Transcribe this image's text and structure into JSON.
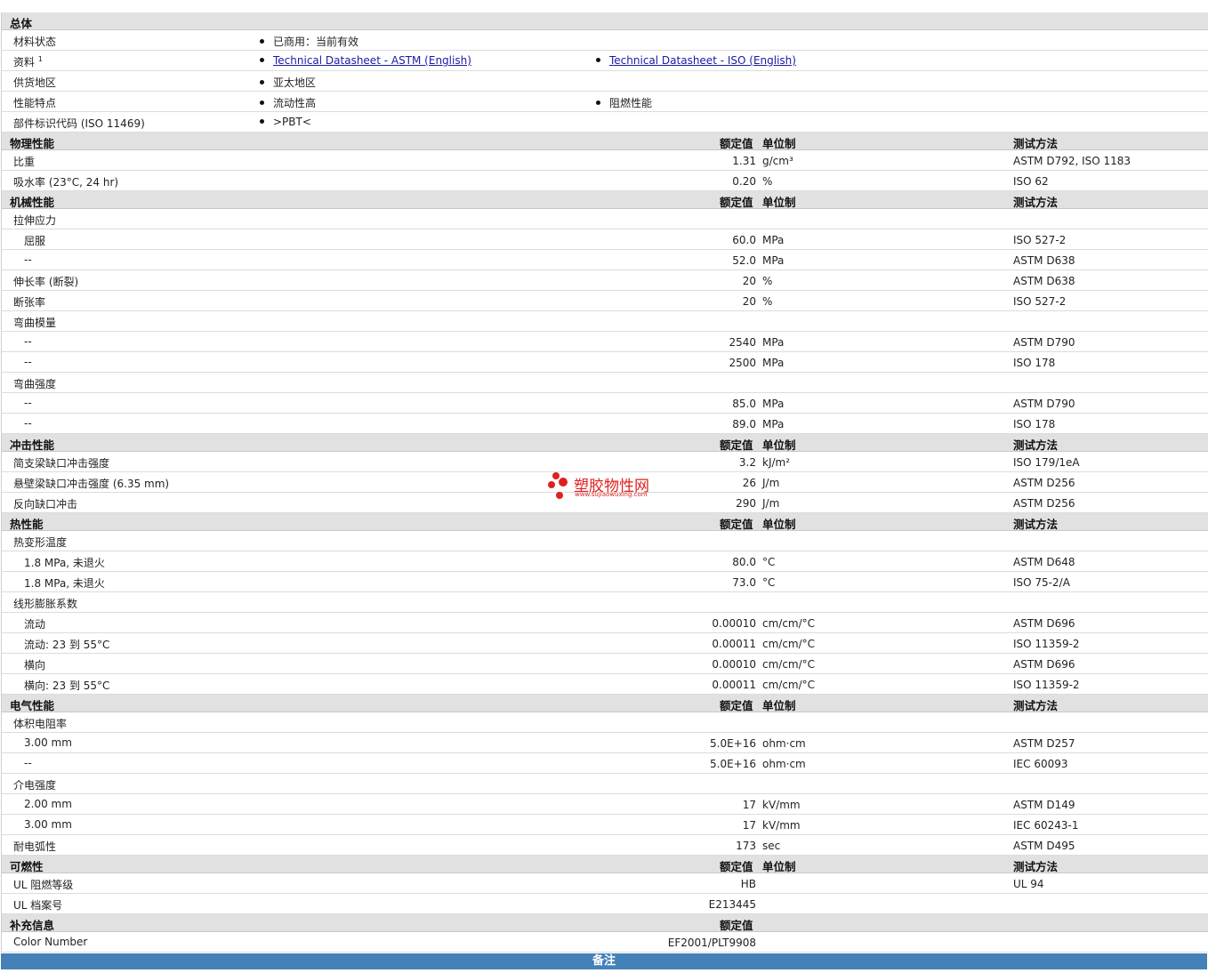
{
  "general": {
    "title": "总体",
    "rows": [
      {
        "label": "材料状态",
        "items": [
          "已商用：当前有效"
        ]
      },
      {
        "label": "资料",
        "sup": "1",
        "links": [
          "Technical Datasheet - ASTM (English)",
          "Technical Datasheet - ISO (English)"
        ]
      },
      {
        "label": "供货地区",
        "items": [
          "亚太地区"
        ]
      },
      {
        "label": "性能特点",
        "items": [
          "流动性高",
          "阻燃性能"
        ]
      },
      {
        "label": "部件标识代码 (ISO 11469)",
        "items": [
          ">PBT<"
        ]
      }
    ]
  },
  "col_headers": {
    "value": "额定值",
    "unit": "单位制",
    "method": "测试方法"
  },
  "physical": {
    "title": "物理性能",
    "rows": [
      {
        "name": "比重",
        "value": "1.31",
        "unit": "g/cm³",
        "method": "ASTM D792, ISO 1183"
      },
      {
        "name": "吸水率 (23°C, 24 hr)",
        "value": "0.20",
        "unit": "%",
        "method": "ISO 62"
      }
    ]
  },
  "mechanical": {
    "title": "机械性能",
    "rows": [
      {
        "name": "拉伸应力",
        "value": "",
        "unit": "",
        "method": ""
      },
      {
        "name": "屈服",
        "value": "60.0",
        "unit": "MPa",
        "method": "ISO 527-2"
      },
      {
        "name": "--",
        "value": "52.0",
        "unit": "MPa",
        "method": "ASTM D638"
      },
      {
        "name": "伸长率 (断裂)",
        "value": "20",
        "unit": "%",
        "method": "ASTM D638"
      },
      {
        "name": "断张率",
        "value": "20",
        "unit": "%",
        "method": "ISO 527-2"
      },
      {
        "name": "弯曲模量",
        "value": "",
        "unit": "",
        "method": ""
      },
      {
        "name": "--",
        "value": "2540",
        "unit": "MPa",
        "method": "ASTM D790"
      },
      {
        "name": "--",
        "value": "2500",
        "unit": "MPa",
        "method": "ISO 178"
      },
      {
        "name": "弯曲强度",
        "value": "",
        "unit": "",
        "method": ""
      },
      {
        "name": "--",
        "value": "85.0",
        "unit": "MPa",
        "method": "ASTM D790"
      },
      {
        "name": "--",
        "value": "89.0",
        "unit": "MPa",
        "method": "ISO 178"
      }
    ]
  },
  "impact": {
    "title": "冲击性能",
    "rows": [
      {
        "name": "简支梁缺口冲击强度",
        "value": "3.2",
        "unit": "kJ/m²",
        "method": "ISO 179/1eA"
      },
      {
        "name": "悬壁梁缺口冲击强度 (6.35 mm)",
        "value": "26",
        "unit": "J/m",
        "method": "ASTM D256"
      },
      {
        "name": "反向缺口冲击",
        "value": "290",
        "unit": "J/m",
        "method": "ASTM D256"
      }
    ]
  },
  "thermal": {
    "title": "热性能",
    "rows": [
      {
        "name": "热变形温度",
        "value": "",
        "unit": "",
        "method": ""
      },
      {
        "name": "1.8 MPa, 未退火",
        "value": "80.0",
        "unit": "°C",
        "method": "ASTM D648"
      },
      {
        "name": "1.8 MPa, 未退火",
        "value": "73.0",
        "unit": "°C",
        "method": "ISO 75-2/A"
      },
      {
        "name": "线形膨胀系数",
        "value": "",
        "unit": "",
        "method": ""
      },
      {
        "name": "流动",
        "value": "0.00010",
        "unit": "cm/cm/°C",
        "method": "ASTM D696"
      },
      {
        "name": "流动: 23 到 55°C",
        "value": "0.00011",
        "unit": "cm/cm/°C",
        "method": "ISO 11359-2"
      },
      {
        "name": "横向",
        "value": "0.00010",
        "unit": "cm/cm/°C",
        "method": "ASTM D696"
      },
      {
        "name": "横向: 23 到 55°C",
        "value": "0.00011",
        "unit": "cm/cm/°C",
        "method": "ISO 11359-2"
      }
    ]
  },
  "electrical": {
    "title": "电气性能",
    "rows": [
      {
        "name": "体积电阻率",
        "value": "",
        "unit": "",
        "method": ""
      },
      {
        "name": "3.00 mm",
        "value": "5.0E+16",
        "unit": "ohm·cm",
        "method": "ASTM D257"
      },
      {
        "name": "--",
        "value": "5.0E+16",
        "unit": "ohm·cm",
        "method": "IEC 60093"
      },
      {
        "name": "介电强度",
        "value": "",
        "unit": "",
        "method": ""
      },
      {
        "name": "2.00 mm",
        "value": "17",
        "unit": "kV/mm",
        "method": "ASTM D149"
      },
      {
        "name": "3.00 mm",
        "value": "17",
        "unit": "kV/mm",
        "method": "IEC 60243-1"
      },
      {
        "name": "耐电弧性",
        "value": "173",
        "unit": "sec",
        "method": "ASTM D495"
      }
    ]
  },
  "flammability": {
    "title": "可燃性",
    "rows": [
      {
        "name": "UL 阻燃等级",
        "value": "HB",
        "unit": "",
        "method": "UL 94"
      },
      {
        "name": "UL 档案号",
        "value": "E213445",
        "unit": "",
        "method": ""
      }
    ]
  },
  "supplemental": {
    "title": "补充信息",
    "value_header": "额定值",
    "rows": [
      {
        "name": "Color Number",
        "value": "EF2001/PLT9908",
        "unit": "",
        "method": ""
      }
    ]
  },
  "footer": {
    "label": "备注"
  },
  "watermark": {
    "title": "塑胶物性网",
    "url": "www.sujiaowuxing.com",
    "color": "#e02020"
  }
}
